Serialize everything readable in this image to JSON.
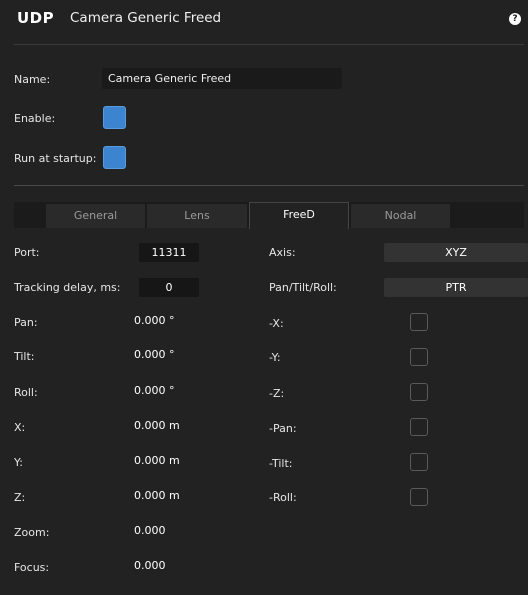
{
  "header": {
    "badge": "UDP",
    "title": "Camera Generic Freed",
    "help_icon": "?"
  },
  "form": {
    "name_label": "Name:",
    "name_value": "Camera Generic Freed",
    "enable_label": "Enable:",
    "enable_checked": true,
    "startup_label": "Run at startup:",
    "startup_checked": true
  },
  "tabs": [
    {
      "label": "General",
      "active": false
    },
    {
      "label": "Lens",
      "active": false
    },
    {
      "label": "FreeD",
      "active": true
    },
    {
      "label": "Nodal",
      "active": false
    }
  ],
  "freed": {
    "port_label": "Port:",
    "port_value": "11311",
    "delay_label": "Tracking delay, ms:",
    "delay_value": "0",
    "axis_label": "Axis:",
    "axis_value": "XYZ",
    "ptr_label": "Pan/Tilt/Roll:",
    "ptr_value": "PTR",
    "readouts": [
      {
        "label": "Pan:",
        "value": "0.000 °"
      },
      {
        "label": "Tilt:",
        "value": "0.000 °"
      },
      {
        "label": "Roll:",
        "value": "0.000 °"
      },
      {
        "label": "X:",
        "value": "0.000 m"
      },
      {
        "label": "Y:",
        "value": "0.000 m"
      },
      {
        "label": "Z:",
        "value": "0.000 m"
      },
      {
        "label": "Zoom:",
        "value": "0.000"
      },
      {
        "label": "Focus:",
        "value": "0.000"
      }
    ],
    "inversions": [
      {
        "label": "-X:",
        "checked": false
      },
      {
        "label": "-Y:",
        "checked": false
      },
      {
        "label": "-Z:",
        "checked": false
      },
      {
        "label": "-Pan:",
        "checked": false
      },
      {
        "label": "-Tilt:",
        "checked": false
      },
      {
        "label": "-Roll:",
        "checked": false
      }
    ]
  },
  "colors": {
    "accent": "#3d84d0",
    "background": "#222222"
  }
}
